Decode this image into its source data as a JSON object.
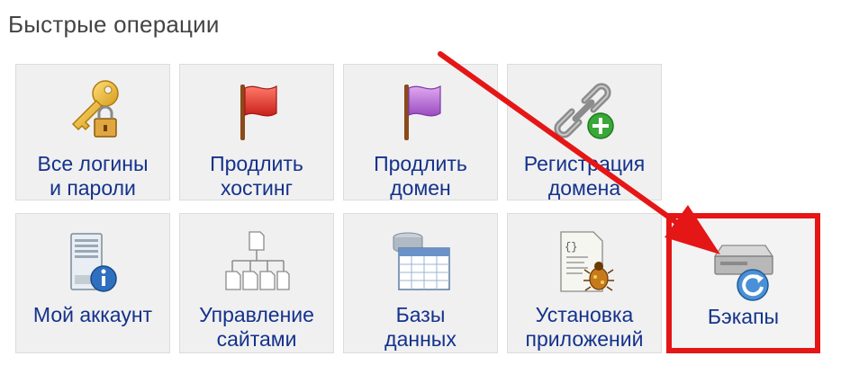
{
  "section": {
    "title": "Быстрые операции"
  },
  "tiles": [
    {
      "line1": "Все логины",
      "line2": "и пароли",
      "icon": "key-lock-icon"
    },
    {
      "line1": "Продлить",
      "line2": "хостинг",
      "icon": "red-flag-icon"
    },
    {
      "line1": "Продлить",
      "line2": "домен",
      "icon": "purple-flag-icon"
    },
    {
      "line1": "Регистрация",
      "line2": "домена",
      "icon": "chain-add-icon"
    },
    {
      "line1": "Мой аккаунт",
      "line2": "",
      "icon": "server-info-icon"
    },
    {
      "line1": "Управление",
      "line2": "сайтами",
      "icon": "sitemap-icon"
    },
    {
      "line1": "Базы",
      "line2": "данных",
      "icon": "database-table-icon"
    },
    {
      "line1": "Установка",
      "line2": "приложений",
      "icon": "script-bug-icon"
    },
    {
      "line1": "Бэкапы",
      "line2": "",
      "icon": "drive-restore-icon"
    }
  ],
  "highlight": {
    "color": "#e51616",
    "target": "Бэкапы"
  }
}
